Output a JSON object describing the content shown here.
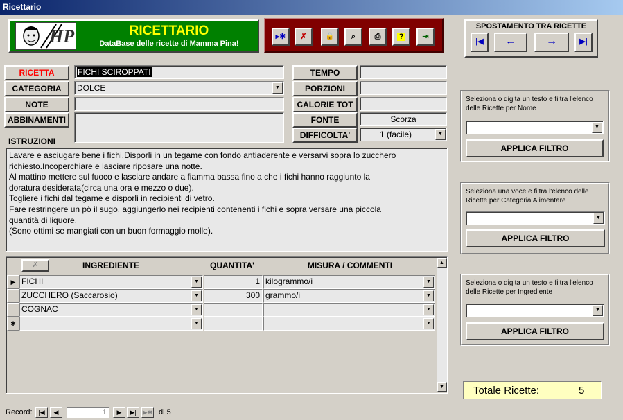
{
  "window": {
    "title": "Ricettario"
  },
  "header": {
    "app_title": "RICETTARIO",
    "app_subtitle": "DataBase delle ricette di Mamma Pina!",
    "logo_letters": "HP"
  },
  "toolbar": {
    "buttons": [
      {
        "name": "new-record-button",
        "glyph": "▸✱"
      },
      {
        "name": "delete-record-button",
        "glyph": "✗"
      },
      {
        "name": "lock-button",
        "glyph": "🔒"
      },
      {
        "name": "find-button",
        "glyph": "⌕"
      },
      {
        "name": "print-button",
        "glyph": "⎙"
      },
      {
        "name": "help-button",
        "glyph": "?"
      },
      {
        "name": "exit-button",
        "glyph": "⇥"
      }
    ]
  },
  "navigation": {
    "title": "SPOSTAMENTO TRA RICETTE",
    "first": "|◀",
    "prev": "←",
    "next": "→",
    "last": "▶|"
  },
  "labels": {
    "ricetta": "RICETTA",
    "categoria": "CATEGORIA",
    "note": "NOTE",
    "abbinamenti": "ABBINAMENTI",
    "istruzioni": "ISTRUZIONI",
    "tempo": "TEMPO",
    "porzioni": "PORZIONI",
    "calorie": "CALORIE TOT",
    "fonte": "FONTE",
    "difficolta": "DIFFICOLTA'"
  },
  "fields": {
    "ricetta": "FICHI SCIROPPATI",
    "categoria": "DOLCE",
    "note": "",
    "abbinamenti": "",
    "tempo": "",
    "porzioni": "",
    "calorie": "",
    "fonte": "Scorza",
    "difficolta": "1 (facile)"
  },
  "istruzioni_lines": [
    "Lavare e asciugare bene i fichi.Disporli in un tegame con fondo antiaderente e versarvi sopra lo zucchero",
    "richiesto.Incoperchiare e lasciare riposare una notte.",
    "Al mattino mettere sul fuoco e lasciare andare a fiamma bassa fino a che i fichi hanno raggiunto la",
    "doratura desiderata(circa una ora e mezzo o due).",
    "Togliere i fichi dal tegame e disporli in recipienti di vetro.",
    "Fare restringere un pò il sugo, aggiungerlo nei recipienti contenenti i fichi e sopra versare una piccola",
    "quantità di liquore.",
    "(Sono ottimi se mangiati con un buon formaggio molle)."
  ],
  "ingredients_grid": {
    "headers": {
      "ingrediente": "INGREDIENTE",
      "quantita": "QUANTITA'",
      "misura": "MISURA / COMMENTI"
    },
    "rows": [
      {
        "selector": "▶",
        "ingrediente": "FICHI",
        "quantita": "1",
        "misura": "kilogrammo/i"
      },
      {
        "selector": "",
        "ingrediente": "ZUCCHERO (Saccarosio)",
        "quantita": "300",
        "misura": "grammo/i"
      },
      {
        "selector": "",
        "ingrediente": "COGNAC",
        "quantita": "",
        "misura": ""
      },
      {
        "selector": "✱",
        "ingrediente": "",
        "quantita": "",
        "misura": ""
      }
    ]
  },
  "filters": [
    {
      "text": "Seleziona o digita un testo e filtra l'elenco delle Ricette per Nome",
      "button": "APPLICA FILTRO"
    },
    {
      "text": "Seleziona una voce e filtra l'elenco delle Ricette per Categoria Alimentare",
      "button": "APPLICA FILTRO"
    },
    {
      "text": "Seleziona o digita un testo e filtra l'elenco delle Ricette per Ingrediente",
      "button": "APPLICA FILTRO"
    }
  ],
  "totale": {
    "label": "Totale Ricette:",
    "value": "5"
  },
  "record_nav": {
    "label": "Record:",
    "current": "1",
    "of_text": "di 5"
  },
  "colors": {
    "header_green": "#008000",
    "header_text": "#ffff00",
    "toolbar_red": "#800000",
    "totale_bg": "#ffffc0",
    "ricetta_label": "#ff0000"
  }
}
